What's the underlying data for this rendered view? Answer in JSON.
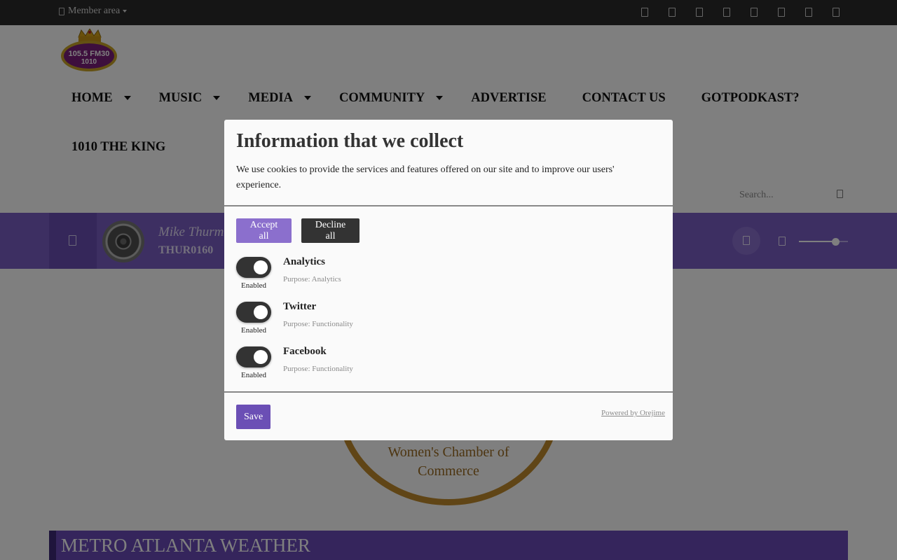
{
  "topbar": {
    "member_label": "Member area",
    "socials": [
      "social-icon-1",
      "social-icon-2",
      "social-icon-3",
      "social-icon-4",
      "social-icon-5",
      "social-icon-6",
      "social-icon-7",
      "social-icon-8"
    ]
  },
  "header": {
    "logo_icon": "station-logo-crown",
    "nav_row1": [
      {
        "label": "HOME",
        "dropdown": true
      },
      {
        "label": "MUSIC",
        "dropdown": true
      },
      {
        "label": "MEDIA",
        "dropdown": true
      },
      {
        "label": "COMMUNITY",
        "dropdown": true
      },
      {
        "label": "ADVERTISE",
        "dropdown": false
      },
      {
        "label": "CONTACT US",
        "dropdown": false
      },
      {
        "label": "GOTPODKAST?",
        "dropdown": false
      }
    ],
    "nav_row2": [
      {
        "label": "1010 THE KING",
        "dropdown": false
      }
    ],
    "search_placeholder": "Search..."
  },
  "player": {
    "track_title": "Mike Thurm",
    "track_code": "THUR0160",
    "volume": 0.75,
    "accent_color": "#7b5fc4"
  },
  "content": {
    "chamber_line1": "Women's Chamber of",
    "chamber_line2": "Commerce",
    "weather_title": "METRO ATLANTA WEATHER"
  },
  "modal": {
    "title": "Information that we collect",
    "description": "We use cookies to provide the services and features offered on our site and to improve our users' experience.",
    "accept_label": "Accept all",
    "decline_label": "Decline all",
    "purposes": [
      {
        "name": "Analytics",
        "state": "Enabled",
        "purpose": "Purpose: Analytics"
      },
      {
        "name": "Twitter",
        "state": "Enabled",
        "purpose": "Purpose: Functionality"
      },
      {
        "name": "Facebook",
        "state": "Enabled",
        "purpose": "Purpose: Functionality"
      }
    ],
    "save_label": "Save",
    "powered_by": "Powered by Orejime"
  }
}
